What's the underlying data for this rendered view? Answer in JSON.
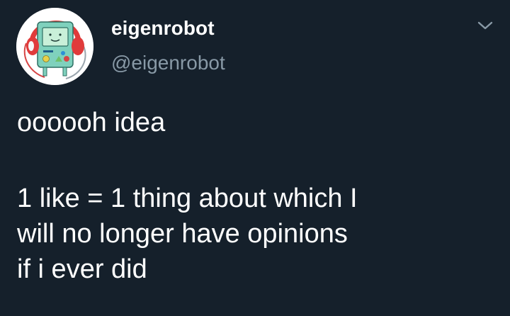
{
  "author": {
    "display_name": "eigenrobot",
    "handle": "@eigenrobot",
    "avatar_icon": "bmo-with-headphones-avatar-icon"
  },
  "menu": {
    "icon": "chevron-down-icon"
  },
  "tweet": {
    "lines": [
      "oooooh idea",
      "1 like = 1 thing about which I",
      "will no longer have opinions",
      "if i ever did"
    ]
  },
  "colors": {
    "background": "#15202b",
    "primary_text": "#ffffff",
    "secondary_text": "#8899a6"
  }
}
